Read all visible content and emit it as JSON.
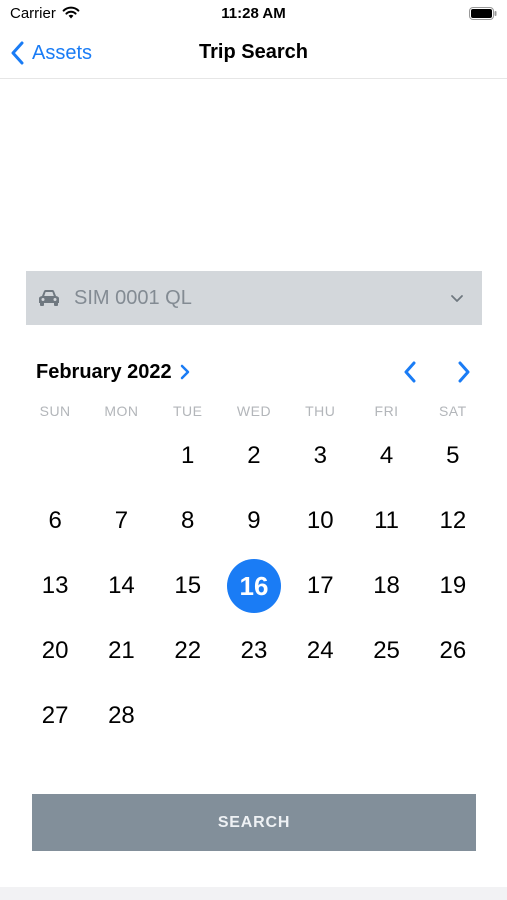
{
  "status_bar": {
    "carrier": "Carrier",
    "time": "11:28 AM",
    "wifi_icon": "wifi-icon",
    "battery_icon": "battery-icon"
  },
  "nav": {
    "back_label": "Assets",
    "back_icon": "chevron-left-icon",
    "title": "Trip Search"
  },
  "vehicle_select": {
    "icon": "car-icon",
    "value": "SIM 0001 QL",
    "dropdown_icon": "chevron-down-icon"
  },
  "calendar": {
    "month_label": "February 2022",
    "weekdays": [
      "SUN",
      "MON",
      "TUE",
      "WED",
      "THU",
      "FRI",
      "SAT"
    ],
    "weeks": [
      [
        "",
        "",
        "1",
        "2",
        "3",
        "4",
        "5"
      ],
      [
        "6",
        "7",
        "8",
        "9",
        "10",
        "11",
        "12"
      ],
      [
        "13",
        "14",
        "15",
        "16",
        "17",
        "18",
        "19"
      ],
      [
        "20",
        "21",
        "22",
        "23",
        "24",
        "25",
        "26"
      ],
      [
        "27",
        "28",
        "",
        "",
        "",
        "",
        ""
      ]
    ],
    "selected_day": "16"
  },
  "search_button_label": "SEARCH",
  "colors": {
    "accent": "#1a7cf5",
    "select_background": "#d3d7db",
    "search_button": "#828f9a"
  }
}
